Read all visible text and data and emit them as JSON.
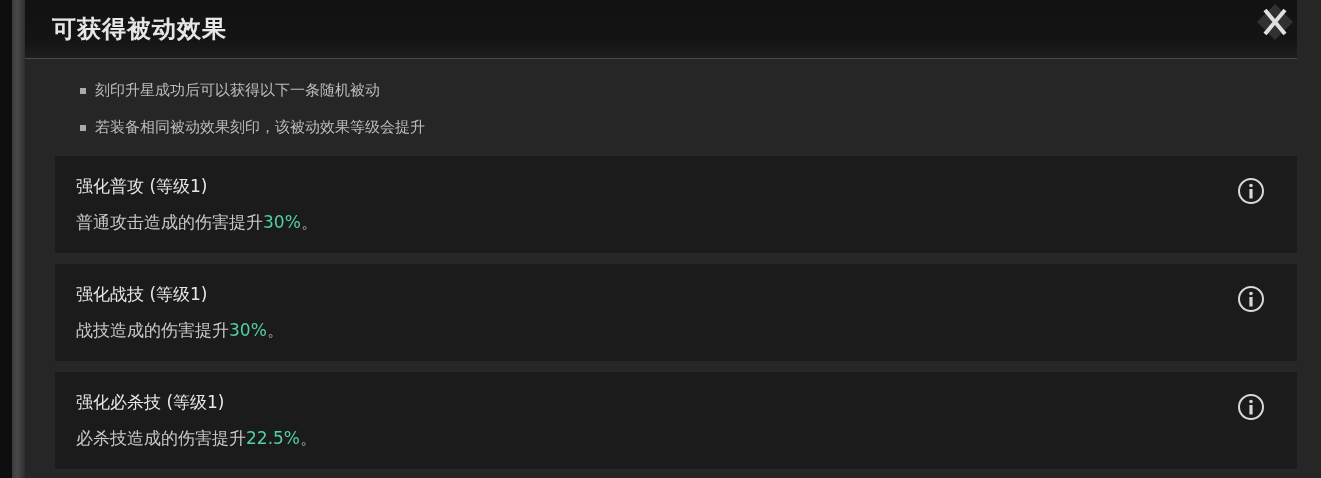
{
  "title": "可获得被动效果",
  "notes": [
    "刻印升星成功后可以获得以下一条随机被动",
    "若装备相同被动效果刻印，该被动效果等级会提升"
  ],
  "effects": [
    {
      "name": "强化普攻 (等级1)",
      "description": "普通攻击造成的伤害提升**30%**。"
    },
    {
      "name": "强化战技 (等级1)",
      "description": "战技造成的伤害提升**30%**。"
    },
    {
      "name": "强化必杀技 (等级1)",
      "description": "必杀技造成的伤害提升**22.5%**。"
    }
  ]
}
